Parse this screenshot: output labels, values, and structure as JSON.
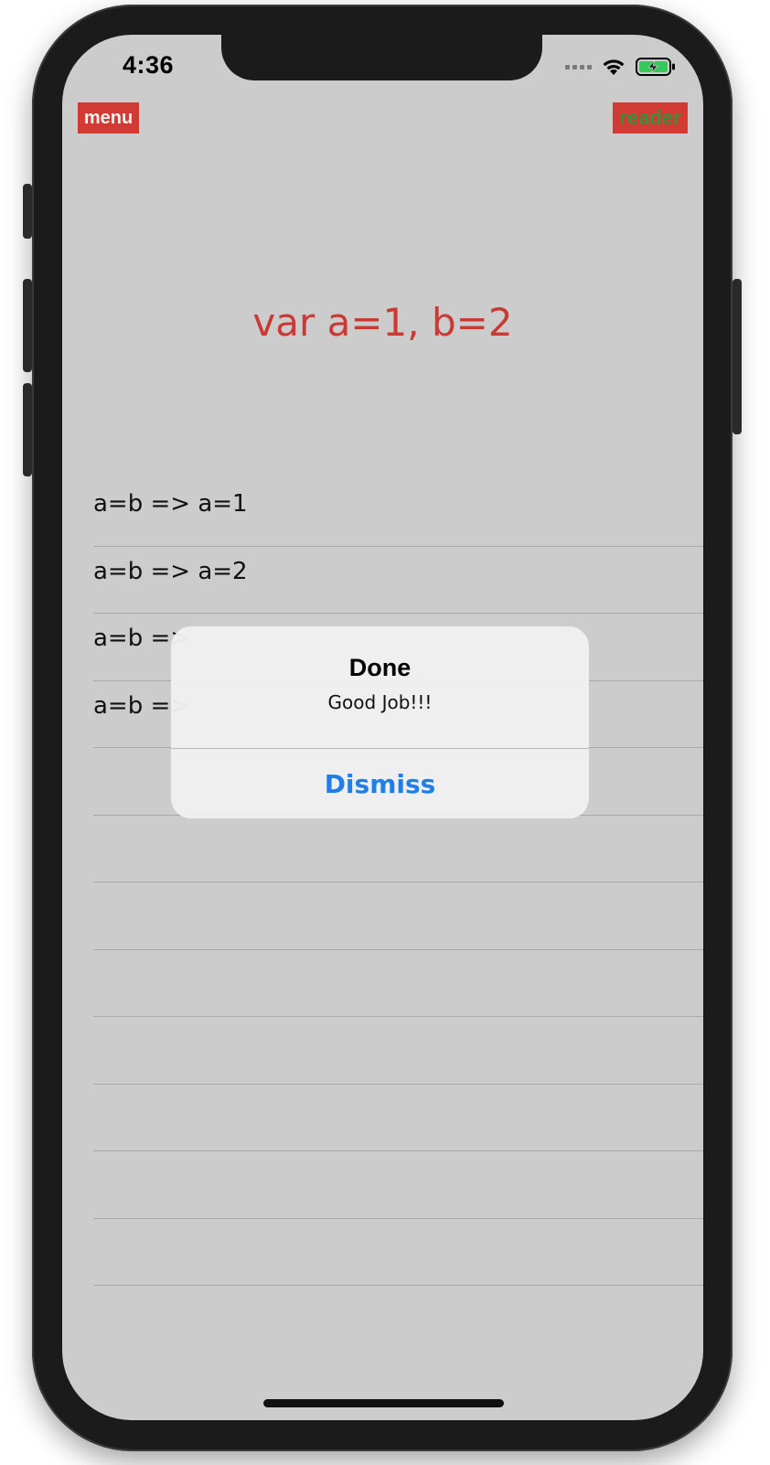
{
  "status_bar": {
    "time": "4:36"
  },
  "toolbar": {
    "menu_label": "menu",
    "reader_label": "reader"
  },
  "heading": "var a=1, b=2",
  "list": {
    "rows": [
      "a=b => a=1",
      "a=b => a=2",
      "a=b => ",
      "a=b => ",
      "",
      "",
      "",
      "",
      "",
      "",
      "",
      ""
    ]
  },
  "alert": {
    "title": "Done",
    "message": "Good Job!!!",
    "dismiss_label": "Dismiss"
  },
  "colors": {
    "screen_bg": "#cccccc",
    "accent_red": "#d23a34",
    "reader_text": "#3a8f3a",
    "link_blue": "#1e7fe8",
    "battery_green": "#34c759"
  }
}
